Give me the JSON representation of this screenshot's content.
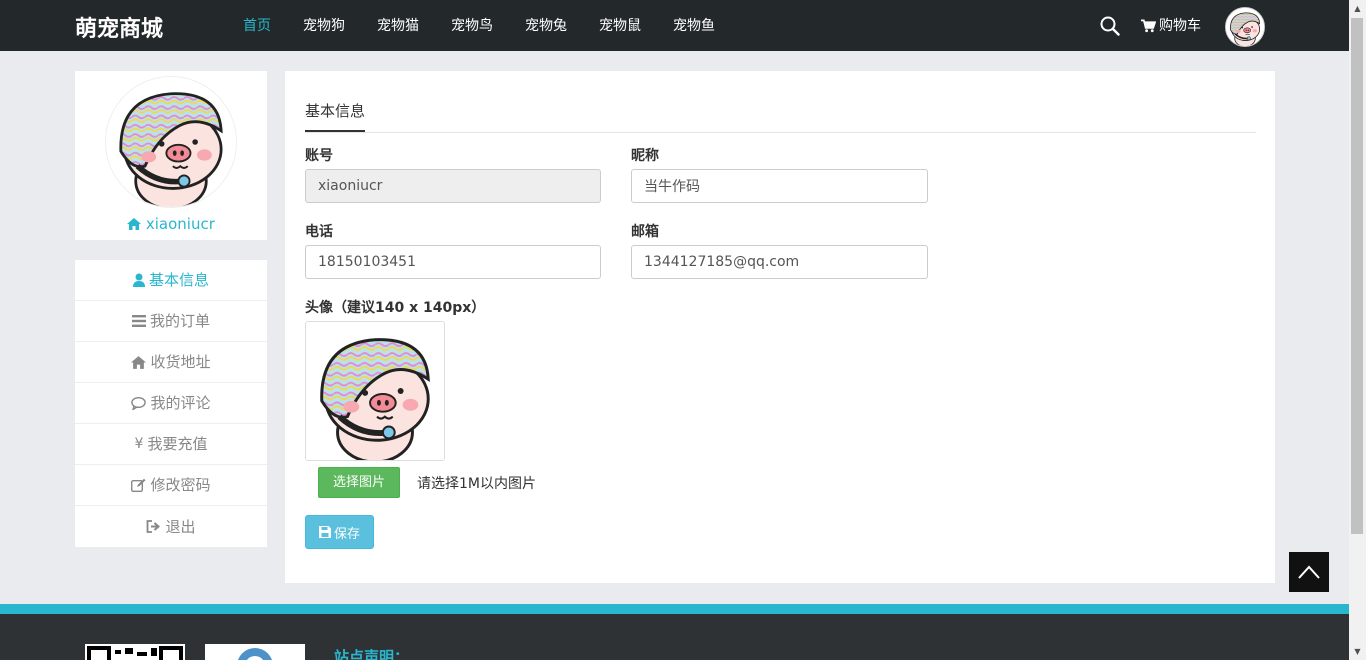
{
  "header": {
    "brand": "萌宠商城",
    "nav": [
      {
        "label": "首页",
        "active": true
      },
      {
        "label": "宠物狗"
      },
      {
        "label": "宠物猫"
      },
      {
        "label": "宠物鸟"
      },
      {
        "label": "宠物兔"
      },
      {
        "label": "宠物鼠"
      },
      {
        "label": "宠物鱼"
      }
    ],
    "cart_label": "购物车",
    "search_icon": "search-icon",
    "cart_icon": "shopping-cart-icon"
  },
  "sidebar": {
    "username": "xiaoniucr",
    "menu": [
      {
        "label": "基本信息",
        "icon": "user-icon",
        "active": true
      },
      {
        "label": "我的订单",
        "icon": "list-icon"
      },
      {
        "label": "收货地址",
        "icon": "home-icon"
      },
      {
        "label": "我的评论",
        "icon": "comment-icon"
      },
      {
        "label": "我要充值",
        "icon": "yen-icon"
      },
      {
        "label": "修改密码",
        "icon": "edit-icon"
      },
      {
        "label": "退出",
        "icon": "sign-out-icon"
      }
    ]
  },
  "form": {
    "tab_label": "基本信息",
    "account_label": "账号",
    "account_value": "xiaoniucr",
    "nickname_label": "昵称",
    "nickname_value": "当牛作码",
    "phone_label": "电话",
    "phone_value": "18150103451",
    "email_label": "邮箱",
    "email_value": "1344127185@qq.com",
    "avatar_label": "头像（建议140 x 140px）",
    "choose_button": "选择图片",
    "choose_hint": "请选择1M以内图片",
    "save_button": "保存"
  },
  "footer": {
    "title": "站点声明："
  },
  "colors": {
    "accent": "#29b7cf",
    "topbar": "#23282b",
    "success": "#5cb85c",
    "info": "#5bc0de"
  }
}
